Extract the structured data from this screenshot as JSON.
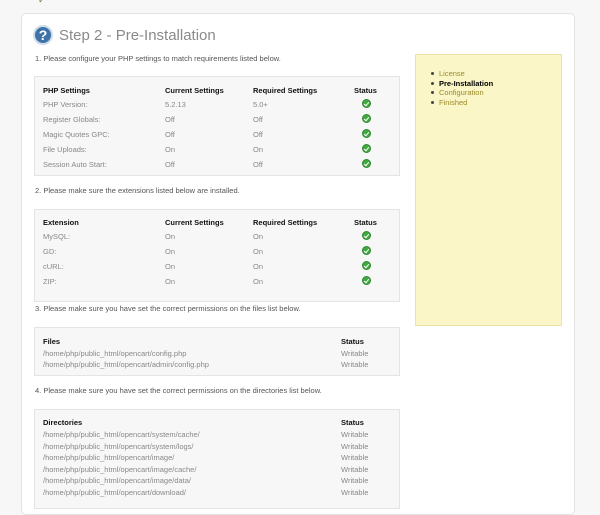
{
  "page": {
    "title": "Step 2 - Pre-Installation"
  },
  "php": {
    "instruction": "1. Please configure your PHP settings to match requirements listed below.",
    "headers": [
      "PHP Settings",
      "Current Settings",
      "Required Settings",
      "Status"
    ],
    "rows": [
      [
        "PHP Version:",
        "5.2.13",
        "5.0+"
      ],
      [
        "Register Globals:",
        "Off",
        "Off"
      ],
      [
        "Magic Quotes GPC:",
        "Off",
        "Off"
      ],
      [
        "File Uploads:",
        "On",
        "On"
      ],
      [
        "Session Auto Start:",
        "Off",
        "Off"
      ]
    ]
  },
  "extensions": {
    "instruction": "2. Please make sure the extensions listed below are installed.",
    "headers": [
      "Extension",
      "Current Settings",
      "Required Settings",
      "Status"
    ],
    "rows": [
      [
        "MySQL:",
        "On",
        "On"
      ],
      [
        "GD:",
        "On",
        "On"
      ],
      [
        "cURL:",
        "On",
        "On"
      ],
      [
        "ZIP:",
        "On",
        "On"
      ]
    ]
  },
  "files": {
    "instruction": "3. Please make sure you have set the correct permissions on the files list below.",
    "headers": [
      "Files",
      "Status"
    ],
    "rows": [
      [
        "/home/php/public_html/opencart/config.php",
        "Writable"
      ],
      [
        "/home/php/public_html/opencart/admin/config.php",
        "Writable"
      ]
    ]
  },
  "directories": {
    "instruction": "4. Please make sure you have set the correct permissions on the directories list below.",
    "headers": [
      "Directories",
      "Status"
    ],
    "rows": [
      [
        "/home/php/public_html/opencart/system/cache/",
        "Writable"
      ],
      [
        "/home/php/public_html/opencart/system/logs/",
        "Writable"
      ],
      [
        "/home/php/public_html/opencart/image/",
        "Writable"
      ],
      [
        "/home/php/public_html/opencart/image/cache/",
        "Writable"
      ],
      [
        "/home/php/public_html/opencart/image/data/",
        "Writable"
      ],
      [
        "/home/php/public_html/opencart/download/",
        "Writable"
      ]
    ]
  },
  "steps": [
    "License",
    "Pre-Installation",
    "Configuration",
    "Finished"
  ],
  "colors": {
    "ok": "#42a842",
    "sidebar_bg": "#fbf6c7",
    "sidebar_link": "#9a8a2a",
    "heading": "#8a8a8a",
    "help_icon": "#3f73a8"
  },
  "icons": {
    "status": "check-circle-icon",
    "help": "question-icon"
  }
}
